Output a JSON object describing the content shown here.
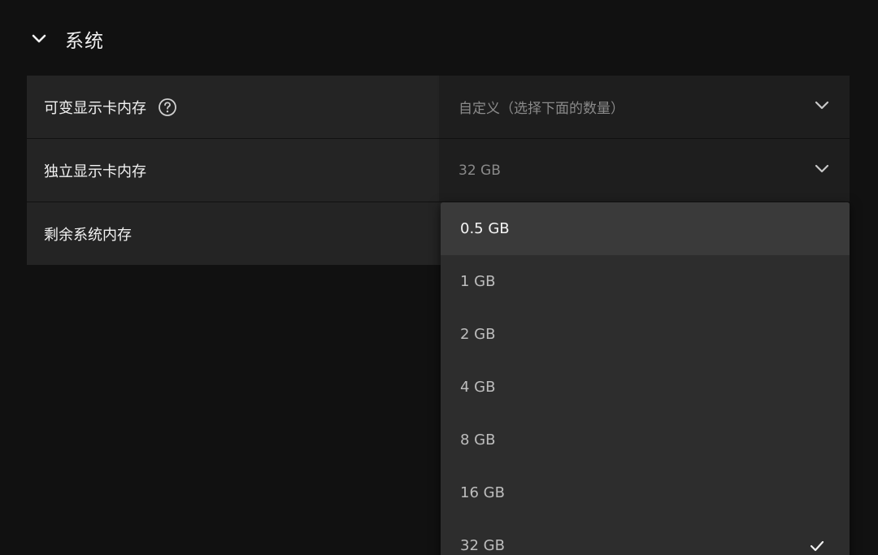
{
  "section": {
    "title": "系统",
    "icon": "chevron-down-icon"
  },
  "settings": [
    {
      "label": "可变显示卡内存",
      "value": "自定义（选择下面的数量）",
      "has_help": true
    },
    {
      "label": "独立显示卡内存",
      "value": "32 GB"
    },
    {
      "label": "剩余系统内存",
      "value": ""
    }
  ],
  "dropdown": {
    "options": [
      "0.5 GB",
      "1 GB",
      "2 GB",
      "4 GB",
      "8 GB",
      "16 GB",
      "32 GB"
    ],
    "hovered": "0.5 GB",
    "selected": "32 GB"
  },
  "colors": {
    "background": "#111111",
    "row": "#242424",
    "dropdown": "#2d2d2d",
    "hover": "#3a3a3a"
  }
}
